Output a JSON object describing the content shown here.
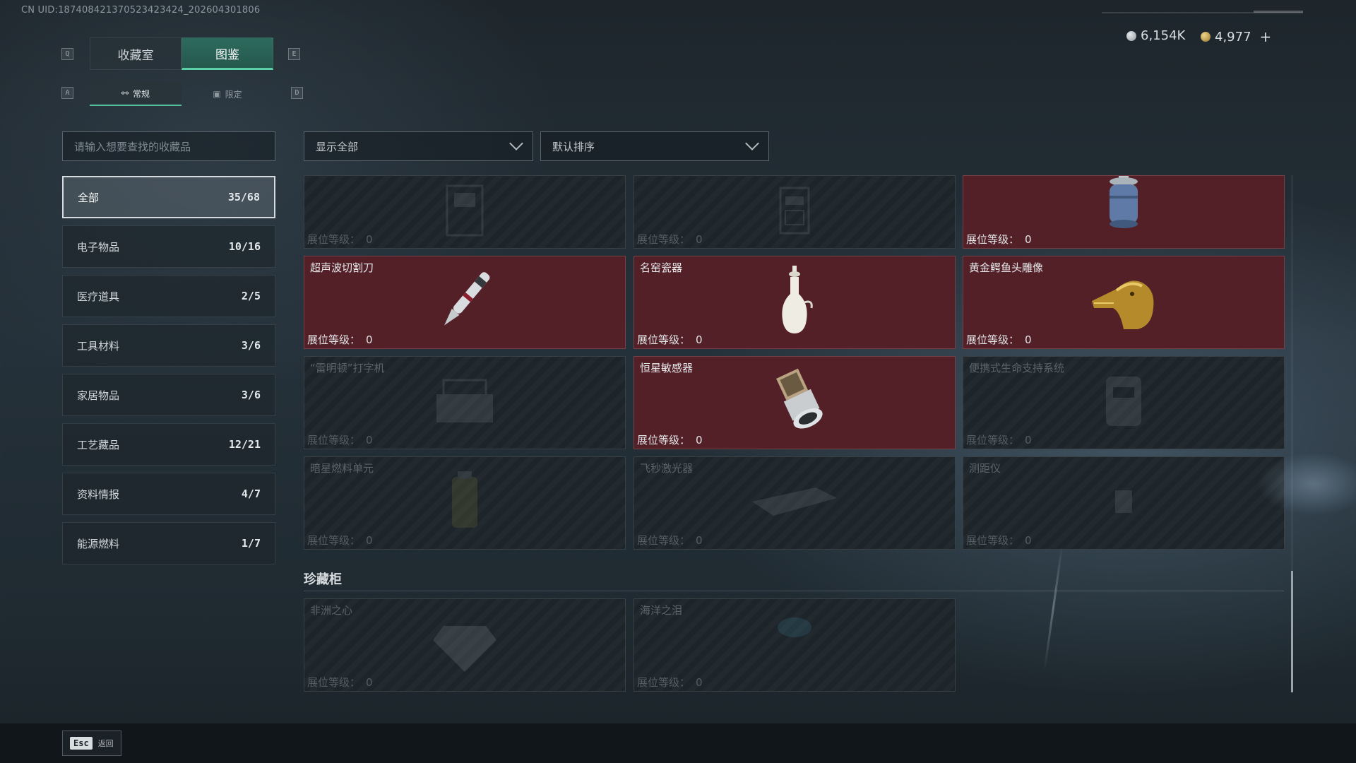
{
  "header": {
    "uid": "CN UID:1874084213705234234​24_202604301806",
    "silver": "6,154K",
    "gold": "4,977",
    "plus": "+"
  },
  "keys": {
    "q": "Q",
    "e": "E",
    "a": "A",
    "d": "D"
  },
  "tabs": [
    {
      "label": "收藏室",
      "active": false
    },
    {
      "label": "图鉴",
      "active": true
    }
  ],
  "subtabs": [
    {
      "label": "常规",
      "icon": "flame-icon",
      "active": true
    },
    {
      "label": "限定",
      "icon": "image-icon",
      "active": false
    }
  ],
  "search": {
    "placeholder": "请输入想要查找的收藏品"
  },
  "categories": [
    {
      "label": "全部",
      "count": "35/68",
      "active": true
    },
    {
      "label": "电子物品",
      "count": "10/16",
      "active": false
    },
    {
      "label": "医疗道具",
      "count": "2/5",
      "active": false
    },
    {
      "label": "工具材料",
      "count": "3/6",
      "active": false
    },
    {
      "label": "家居物品",
      "count": "3/6",
      "active": false
    },
    {
      "label": "工艺藏品",
      "count": "12/21",
      "active": false
    },
    {
      "label": "资料情报",
      "count": "4/7",
      "active": false
    },
    {
      "label": "能源燃料",
      "count": "1/7",
      "active": false
    }
  ],
  "filters": {
    "show": "显示全部",
    "sort": "默认排序"
  },
  "level_label": "展位等级：",
  "items": [
    {
      "name": "",
      "level": "0",
      "owned": false,
      "icon": "cabinet-icon"
    },
    {
      "name": "",
      "level": "0",
      "owned": false,
      "icon": "device-icon"
    },
    {
      "name": "",
      "level": "0",
      "owned": true,
      "icon": "gas-canister-icon"
    },
    {
      "name": "超声波切割刀",
      "level": "0",
      "owned": true,
      "icon": "ultrasonic-cutter-icon"
    },
    {
      "name": "名窑瓷器",
      "level": "0",
      "owned": true,
      "icon": "porcelain-vase-icon"
    },
    {
      "name": "黄金鳄鱼头雕像",
      "level": "0",
      "owned": true,
      "icon": "golden-crocodile-icon"
    },
    {
      "name": "“雷明顿”打字机",
      "level": "0",
      "owned": false,
      "icon": "typewriter-icon"
    },
    {
      "name": "恒星敏感器",
      "level": "0",
      "owned": true,
      "icon": "star-sensor-icon"
    },
    {
      "name": "便携式生命支持系统",
      "level": "0",
      "owned": false,
      "icon": "life-support-icon"
    },
    {
      "name": "暗星燃料单元",
      "level": "0",
      "owned": false,
      "icon": "fuel-cell-icon"
    },
    {
      "name": "飞秒激光器",
      "level": "0",
      "owned": false,
      "icon": "laser-icon"
    },
    {
      "name": "测距仪",
      "level": "0",
      "owned": false,
      "icon": "rangefinder-icon"
    }
  ],
  "section": {
    "title": "珍藏柜"
  },
  "treasures": [
    {
      "name": "非洲之心",
      "level": "0",
      "owned": false,
      "icon": "diamond-icon"
    },
    {
      "name": "海洋之泪",
      "level": "0",
      "owned": false,
      "icon": "gem-icon"
    }
  ],
  "footer": {
    "esc_key": "Esc",
    "esc_label": "返回"
  }
}
